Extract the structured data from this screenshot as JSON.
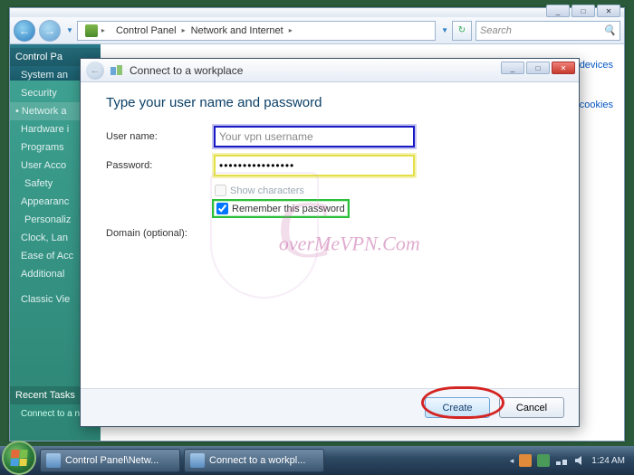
{
  "explorer": {
    "window_controls": {
      "min": "_",
      "max": "□",
      "close": "✕"
    },
    "nav": {
      "back": "←",
      "forward": "→",
      "refresh": "↻"
    },
    "breadcrumb": {
      "seg1": "Control Panel",
      "seg2": "Network and Internet"
    },
    "search_placeholder": "Search"
  },
  "sidebar": {
    "header": "Control Pa",
    "items": [
      "System an",
      "Security",
      "Network a",
      "Hardware i",
      "Programs",
      "User Acco",
      "Safety",
      "Appearanc",
      "Personaliz",
      "Clock, Lan",
      "Ease of Acc",
      "Additional"
    ],
    "classic": "Classic Vie",
    "recent_header": "Recent Tasks",
    "recent_item": "Connect to a network"
  },
  "main_links": {
    "link1": "and devices",
    "link2": "cookies"
  },
  "dialog": {
    "title": "Connect to a workplace",
    "headline": "Type your user name and password",
    "username_label": "User name:",
    "username_value": "Your vpn username",
    "password_label": "Password:",
    "password_value": "••••••••••••••••",
    "show_chars_label": "Show characters",
    "remember_label": "Remember this password",
    "domain_label": "Domain (optional):",
    "create_btn": "Create",
    "cancel_btn": "Cancel",
    "back": "←",
    "window_controls": {
      "min": "_",
      "max": "□",
      "close": "✕"
    }
  },
  "watermark": {
    "shield_letter": "C",
    "text": "overMeVPN.Com"
  },
  "taskbar": {
    "items": [
      "Control Panel\\Netw...",
      "Connect to a workpl..."
    ],
    "time": "1:24 AM"
  },
  "colors": {
    "hl_blue": "#1718c5",
    "hl_yellow": "#e3e047",
    "hl_green": "#2bbf3a",
    "hl_red": "#d42522"
  }
}
